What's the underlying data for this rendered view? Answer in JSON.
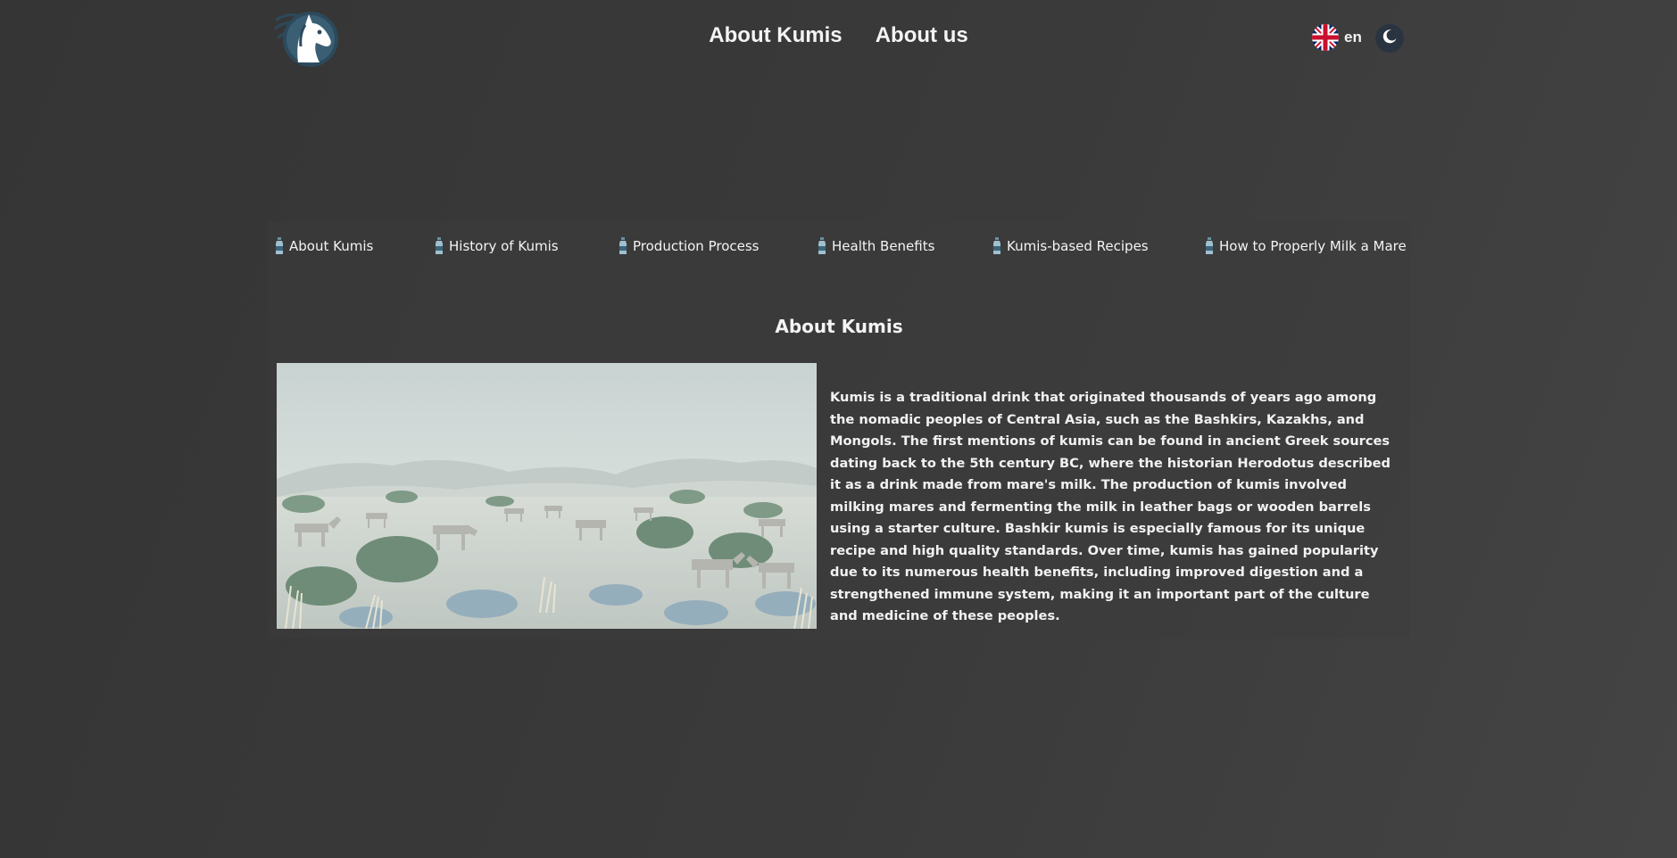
{
  "header": {
    "nav": [
      {
        "label": "About Kumis"
      },
      {
        "label": "About us"
      }
    ],
    "language": {
      "code": "en",
      "flag_icon": "uk-flag-icon"
    },
    "theme_toggle_icon": "moon-icon"
  },
  "tabs": [
    {
      "label": "About Kumis",
      "icon": "bottle-icon"
    },
    {
      "label": "History of Kumis",
      "icon": "bottle-icon"
    },
    {
      "label": "Production Process",
      "icon": "bottle-icon"
    },
    {
      "label": "Health Benefits",
      "icon": "bottle-icon"
    },
    {
      "label": "Kumis-based Recipes",
      "icon": "bottle-icon"
    },
    {
      "label": "How to Properly Milk a Mare",
      "icon": "bottle-icon"
    }
  ],
  "section": {
    "title": "About Kumis",
    "description": "Kumis is a traditional drink that originated thousands of years ago among the nomadic peoples of Central Asia, such as the Bashkirs, Kazakhs, and Mongols. The first mentions of kumis can be found in ancient Greek sources dating back to the 5th century BC, where the historian Herodotus described it as a drink made from mare's milk. The production of kumis involved milking mares and fermenting the milk in leather bags or wooden barrels using a starter culture. Bashkir kumis is especially famous for its unique recipe and high quality standards. Over time, kumis has gained popularity due to its numerous health benefits, including improved digestion and a strengthened immune system, making it an important part of the culture and medicine of these peoples."
  },
  "colors": {
    "background": "#3a3a3a",
    "text": "#f2f2f2",
    "theme_toggle_bg": "#2a3440",
    "logo_circle": "#2c4a5c"
  }
}
